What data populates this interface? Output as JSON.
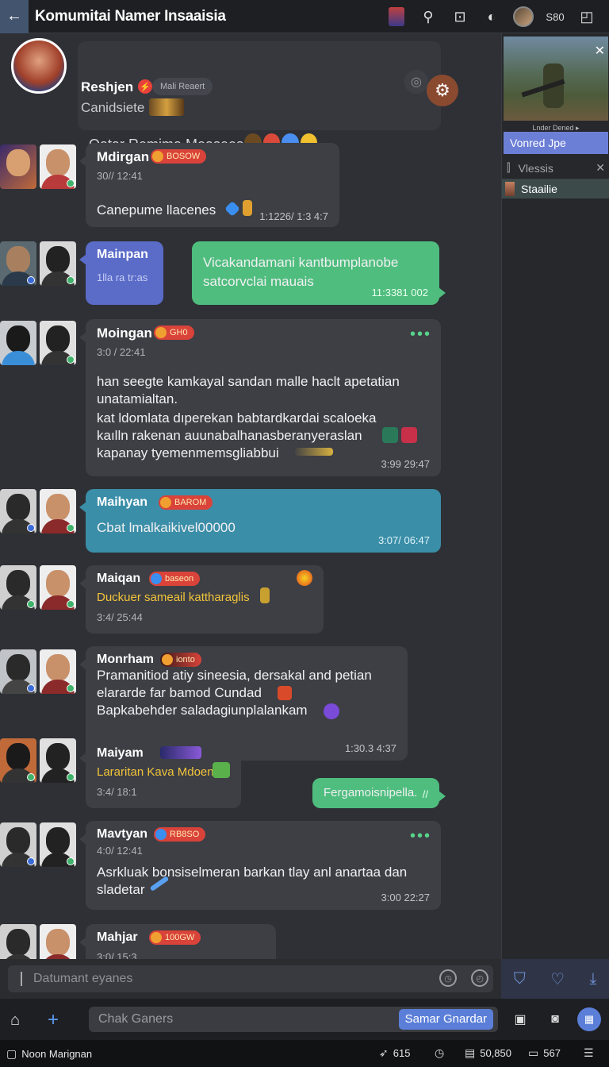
{
  "topbar": {
    "back_icon": "arrow-left-icon",
    "title": "Komumitai Namer Insaaisia",
    "count": "S80"
  },
  "group": {
    "name": "Reshjen",
    "pill": "Mali Reaert",
    "subtitle": "Canidsiete",
    "description": "Oatar Remima Measees"
  },
  "messages": [
    {
      "sender": "Mdirgan",
      "badge": "BOSOW",
      "stamp": "30// 12:41",
      "text": "Canepume llacenes",
      "time": "1:1226/ 1:3 4:7"
    },
    {
      "sender": "Mainpan",
      "stamp": "1lla ra  tr:as"
    },
    {
      "text_lines": [
        "Vicakandamani kantbumplanobe",
        "satcorvclai mauais"
      ],
      "time": "11:3381 002"
    },
    {
      "sender": "Moingan",
      "badge": "GH0",
      "stamp": "3:0 / 22:41",
      "text_lines": [
        "han seegte kamkayal sandan malle haclt apetatian",
        "unatamialtan.",
        "kat ldomlata dıperekan babtardkardai scaloeka",
        "kaılln rakenan auunabalhanasberanyeraslan",
        "kapanay tyemenmemsgliabbui"
      ],
      "time": "3:99 29:47"
    },
    {
      "sender": "Maihyan",
      "badge": "BAROM",
      "text": "Cbat lmalkaikivel00000",
      "time": "3:07/ 06:47"
    },
    {
      "sender": "Maiqan",
      "badge": "baseon",
      "text": "Duckuer sameail kattharaglis",
      "stamp": "3:4/ 25:44"
    },
    {
      "sender": "Monrham",
      "badge": "ionto",
      "text_lines": [
        "Pramanitiod atiy sineesia, dersakal and petian",
        "elararde far bamod Cundad",
        "Bapkabehder saladagiunplalankam"
      ],
      "time": "1:30.3 4:37"
    },
    {
      "sender": "Maiyam",
      "text": "Lararitan Kava Mdoens",
      "stamp": "3:4/ 18:1"
    },
    {
      "text": "Fergamoisnipella.",
      "time": "//"
    },
    {
      "sender": "Mavtyan",
      "badge": "RB8SO",
      "stamp": "4:0/ 12:41",
      "text_lines": [
        "Asrkluak bonsiselmeran barkan tlay anl anartaa dan",
        "sladetar"
      ],
      "time": "3:00 22:27"
    },
    {
      "sender": "Mahjar",
      "badge": "100GW",
      "stamp": "3:0/ 15:3"
    }
  ],
  "sidepanel": {
    "game_caption": "Lnder Dened  ▸",
    "game_title": "Vonred Jpe",
    "section_title": "Vlessis",
    "row_label": "Staailie"
  },
  "composer": {
    "placeholder": "Datumant eyanes"
  },
  "bottombar": {
    "placeholder": "Chak Ganers",
    "send_label": "Samar Gnardar"
  },
  "statusbar": {
    "left": "Noon Marignan",
    "item1": "615",
    "item2": "50,850",
    "item3": "567"
  },
  "colors": {
    "accent": "#5b7fd8",
    "green_bubble": "#4fbd7e",
    "teal_bubble": "#3b8ea8",
    "purple_bubble": "#5a6bc8",
    "badge_red": "#d9433a"
  }
}
